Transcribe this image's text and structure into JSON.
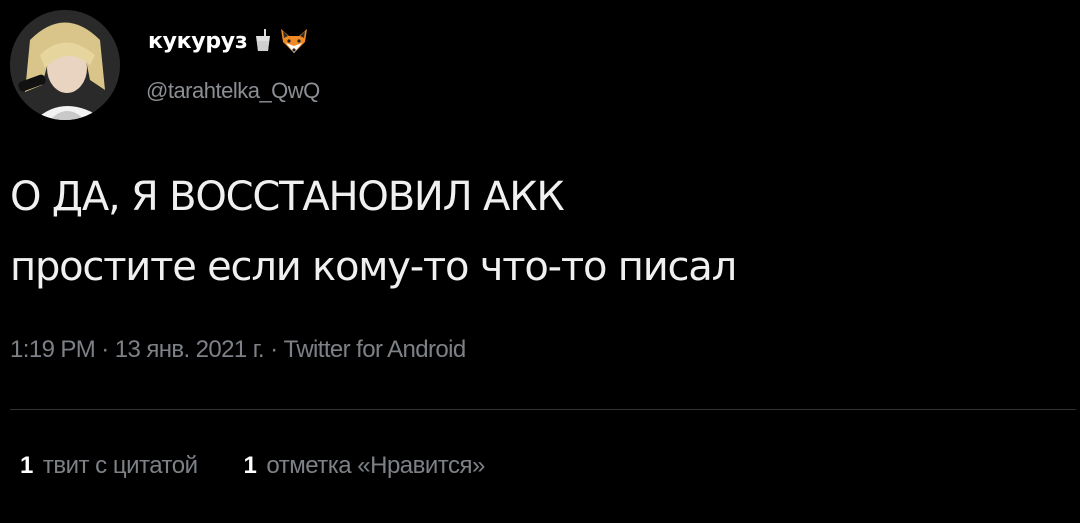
{
  "author": {
    "display_name": "кукуруз",
    "handle": "@tarahtelka_QwQ",
    "badges": [
      "juice-cup-icon",
      "fox-face-icon"
    ]
  },
  "tweet": {
    "line1": "О ДА, Я ВОССТАНОВИЛ АКК",
    "line2": "простите если кому-то что-то писал"
  },
  "meta": {
    "time": "1:19 PM",
    "separator": "·",
    "date": "13 янв. 2021 г.",
    "source": "Twitter for Android"
  },
  "stats": {
    "quotes_count": "1",
    "quotes_label": "твит с цитатой",
    "likes_count": "1",
    "likes_label": "отметка «Нравится»"
  },
  "colors": {
    "background": "#000000",
    "text": "#f0f0f0",
    "secondary": "#7d8186",
    "divider": "#2f3336"
  }
}
